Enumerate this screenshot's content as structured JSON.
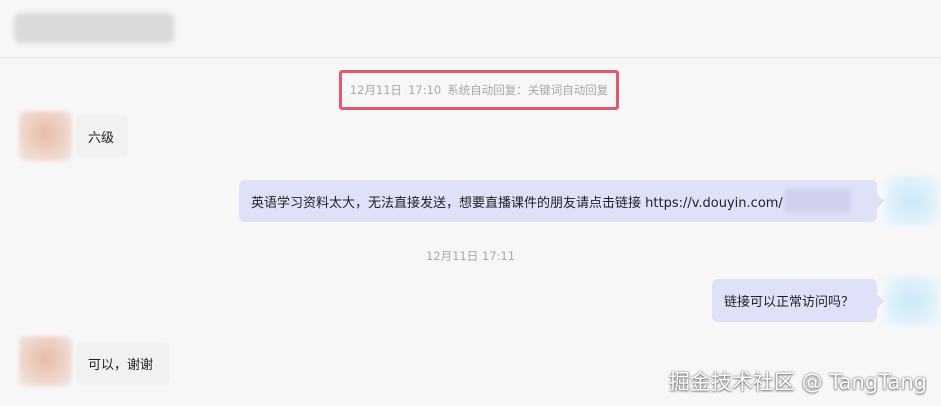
{
  "system_message": {
    "date": "12月11日",
    "time": "17:10",
    "text": "系统自动回复：关键词自动回复"
  },
  "timestamp": "12月11日 17:11",
  "messages": [
    {
      "side": "left",
      "text": "六级"
    },
    {
      "side": "right",
      "text": "英语学习资料太大，无法直接发送，想要直播课件的朋友请点击链接 https://v.douyin.com/"
    },
    {
      "side": "right",
      "text": "链接可以正常访问吗？"
    },
    {
      "side": "left",
      "text": "可以，谢谢"
    }
  ],
  "watermark": "掘金技术社区 @ TangTang",
  "colors": {
    "highlight_border": "#e6596d",
    "right_bubble": "#dfe1f8",
    "left_bubble": "#f1f1f3",
    "muted_text": "#a7a7ad"
  }
}
